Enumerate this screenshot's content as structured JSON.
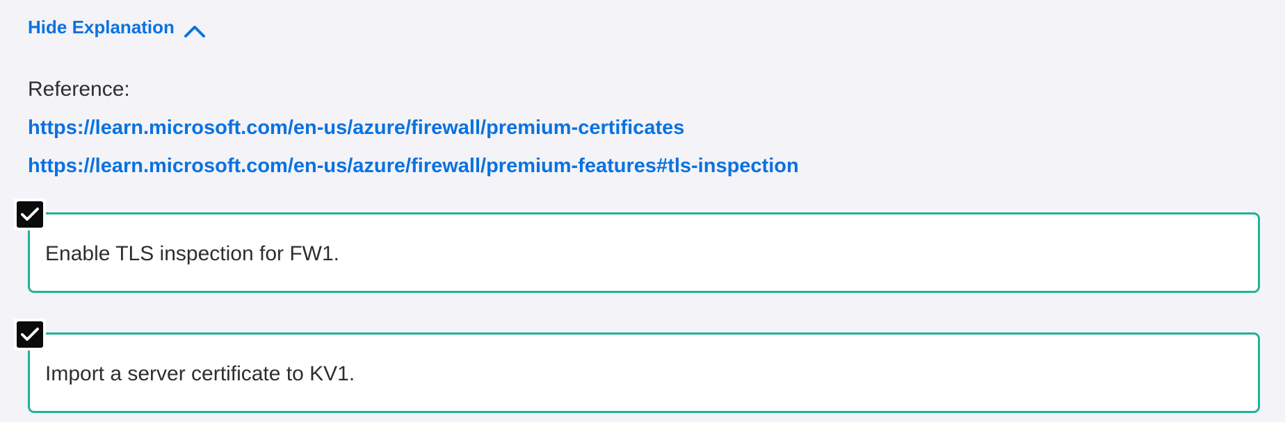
{
  "explanation": {
    "toggle_label": "Hide Explanation",
    "toggle_icon": "chevron-up-icon",
    "reference_label": "Reference:",
    "links": [
      "https://learn.microsoft.com/en-us/azure/firewall/premium-certificates",
      "https://learn.microsoft.com/en-us/azure/firewall/premium-features#tls-inspection"
    ]
  },
  "answers": [
    {
      "text": "Enable TLS inspection for FW1.",
      "checked": true
    },
    {
      "text": "Import a server certificate to KV1.",
      "checked": true
    }
  ],
  "colors": {
    "accent_link": "#0a72e0",
    "answer_border": "#1db397",
    "background": "#f3f3f8",
    "checkbox": "#0b0b0b"
  }
}
